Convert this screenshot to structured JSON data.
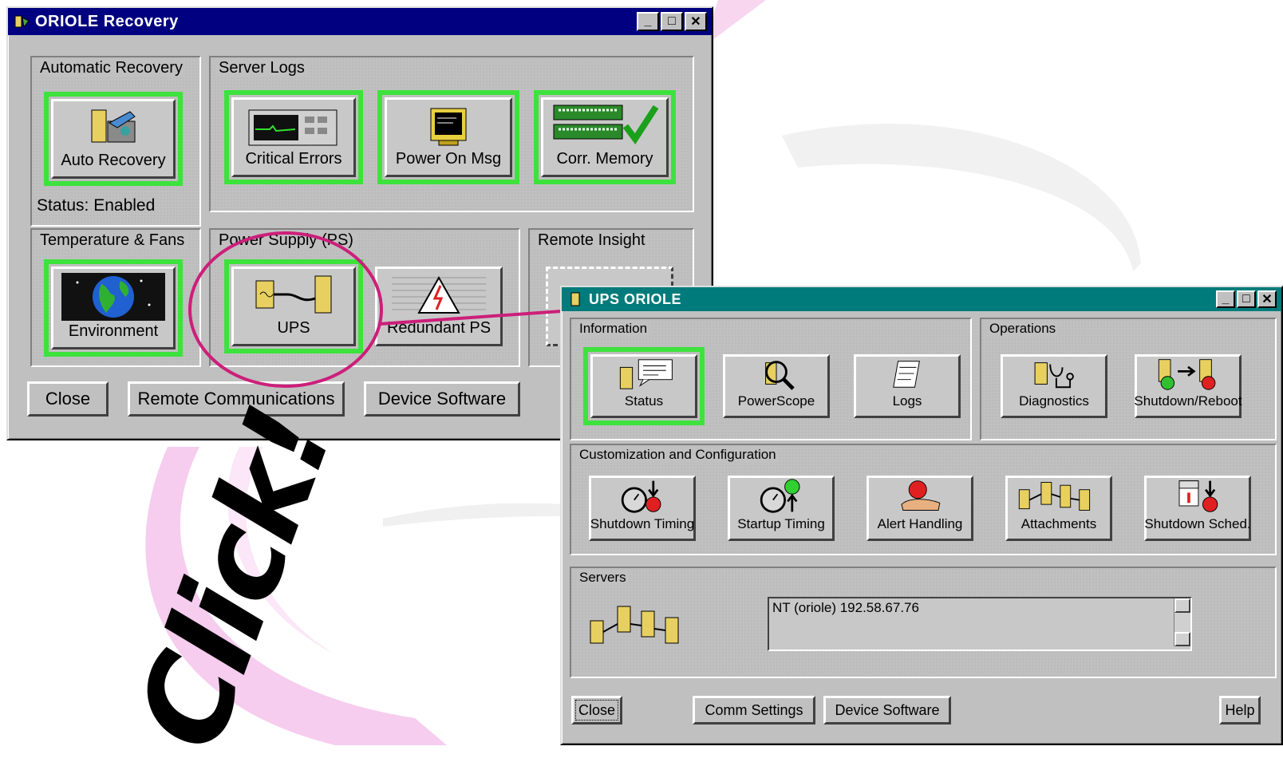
{
  "background": {
    "click_text": "Click!",
    "accent_color": "#cc1f7a"
  },
  "recovery_window": {
    "title": "ORIOLE Recovery",
    "title_bar_color": "#000080",
    "groups": {
      "auto": {
        "label": "Automatic Recovery",
        "tile": "Auto Recovery",
        "status": "Status: Enabled"
      },
      "logs": {
        "label": "Server Logs",
        "tiles": [
          "Critical Errors",
          "Power On Msg",
          "Corr. Memory"
        ]
      },
      "temp": {
        "label": "Temperature & Fans",
        "tile": "Environment"
      },
      "power": {
        "label": "Power Supply (PS)",
        "tiles": [
          "UPS",
          "Redundant PS"
        ]
      },
      "remote": {
        "label": "Remote Insight"
      }
    },
    "buttons": {
      "close": "Close",
      "remote": "Remote Communications",
      "device": "Device Software"
    }
  },
  "ups_window": {
    "title": "UPS ORIOLE",
    "title_bar_color": "#007b7b",
    "information": {
      "label": "Information",
      "tiles": [
        "Status",
        "PowerScope",
        "Logs"
      ]
    },
    "operations": {
      "label": "Operations",
      "tiles": [
        "Diagnostics",
        "Shutdown/Reboot"
      ]
    },
    "customization": {
      "label": "Customization and Configuration",
      "tiles": [
        "Shutdown Timing",
        "Startup Timing",
        "Alert Handling",
        "Attachments",
        "Shutdown Sched."
      ]
    },
    "servers": {
      "label": "Servers",
      "list_item": "NT (oriole) 192.58.67.76"
    },
    "buttons": {
      "close": "Close",
      "comm": "Comm Settings",
      "device": "Device Software",
      "help": "Help"
    }
  }
}
